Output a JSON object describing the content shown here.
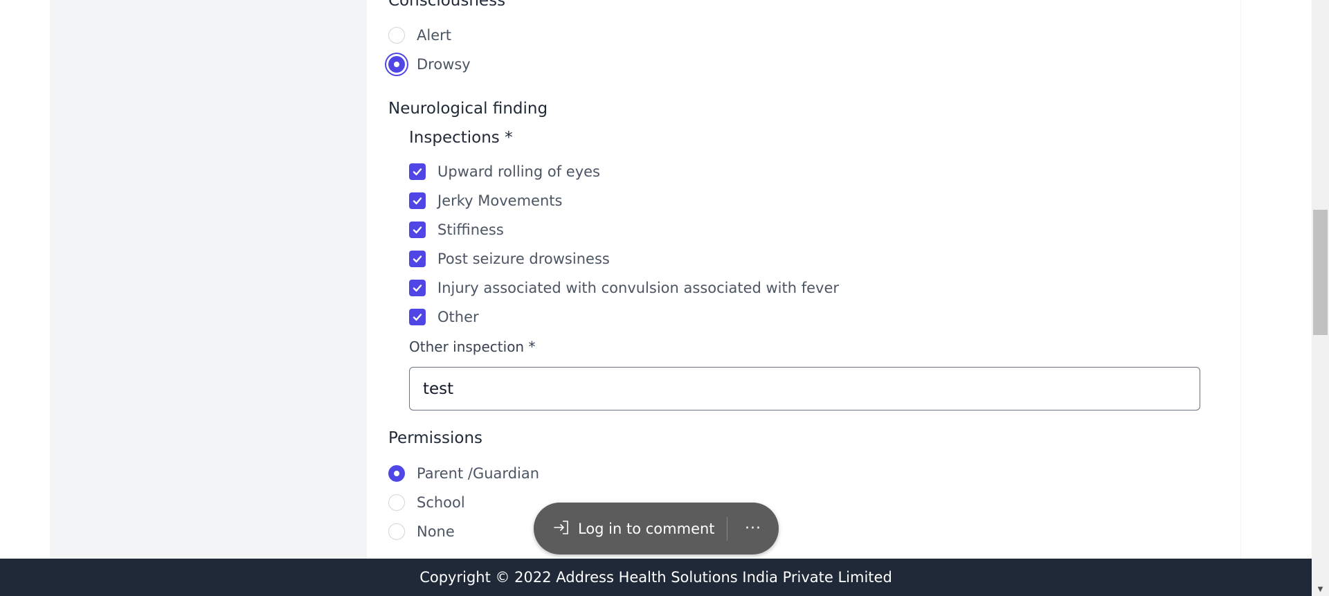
{
  "consciousness": {
    "heading": "Consciousness",
    "options": [
      {
        "label": "Alert",
        "selected": false
      },
      {
        "label": "Drowsy",
        "selected": true
      }
    ]
  },
  "neurological": {
    "heading": "Neurological finding",
    "inspections": {
      "heading": "Inspections *",
      "items": [
        {
          "label": "Upward rolling of eyes",
          "checked": true
        },
        {
          "label": "Jerky Movements",
          "checked": true
        },
        {
          "label": "Stiffiness",
          "checked": true
        },
        {
          "label": "Post seizure drowsiness",
          "checked": true
        },
        {
          "label": "Injury associated with convulsion associated with fever",
          "checked": true
        },
        {
          "label": "Other",
          "checked": true
        }
      ]
    },
    "other_inspection": {
      "label": "Other inspection *",
      "value": "test"
    }
  },
  "permissions": {
    "heading": "Permissions",
    "options": [
      {
        "label": "Parent /Guardian",
        "selected": true
      },
      {
        "label": "School",
        "selected": false
      },
      {
        "label": "None",
        "selected": false
      }
    ]
  },
  "comment_pill": {
    "login_label": "Log in to comment",
    "more_label": "···",
    "login_icon": "sign-in-icon"
  },
  "footer": {
    "copyright": "Copyright © 2022 Address Health Solutions India Private Limited"
  },
  "colors": {
    "accent": "#4f46e5",
    "footer_bg": "#1f2937",
    "page_bg": "#f3f4f6"
  }
}
